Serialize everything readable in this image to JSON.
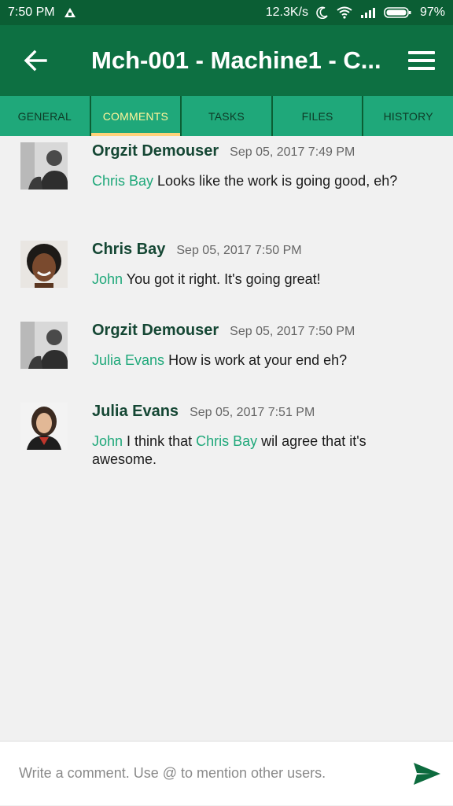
{
  "status_bar": {
    "time": "7:50 PM",
    "speed": "12.3K/s",
    "battery": "97%",
    "icons": [
      "notification-icon",
      "moon-icon",
      "wifi-icon",
      "signal-icon",
      "battery-icon"
    ]
  },
  "app_bar": {
    "title": "Mch-001 - Machine1 - C...",
    "back_icon": "back-arrow-icon",
    "menu_icon": "hamburger-menu-icon"
  },
  "tabs": [
    {
      "label": "GENERAL",
      "active": false
    },
    {
      "label": "COMMENTS",
      "active": true
    },
    {
      "label": "TASKS",
      "active": false
    },
    {
      "label": "FILES",
      "active": false
    },
    {
      "label": "HISTORY",
      "active": false
    }
  ],
  "comments": [
    {
      "author": "Orgzit Demouser",
      "time": "Sep 05, 2017 7:49 PM",
      "mention": "Chris Bay",
      "text": " Looks like the work is going good, eh?"
    },
    {
      "author": "Chris Bay",
      "time": "Sep 05, 2017 7:50 PM",
      "mention": "John",
      "text": " You got it right. It's going great!"
    },
    {
      "author": "Orgzit Demouser",
      "time": "Sep 05, 2017 7:50 PM",
      "mention": "Julia Evans",
      "text": " How is work at your end eh?"
    },
    {
      "author": "Julia Evans",
      "time": "Sep 05, 2017 7:51 PM",
      "mention": "John",
      "text_a": " I think that ",
      "mention_b": "Chris Bay",
      "text_b": " wil agree that it's awesome."
    }
  ],
  "input": {
    "placeholder": "Write a comment. Use @ to mention other users."
  },
  "colors": {
    "status_bar": "#0b5e34",
    "app_bar": "#0d7042",
    "tabs": "#1fa87a",
    "active_tab_text": "#fff59a",
    "mention": "#1fa87a"
  }
}
